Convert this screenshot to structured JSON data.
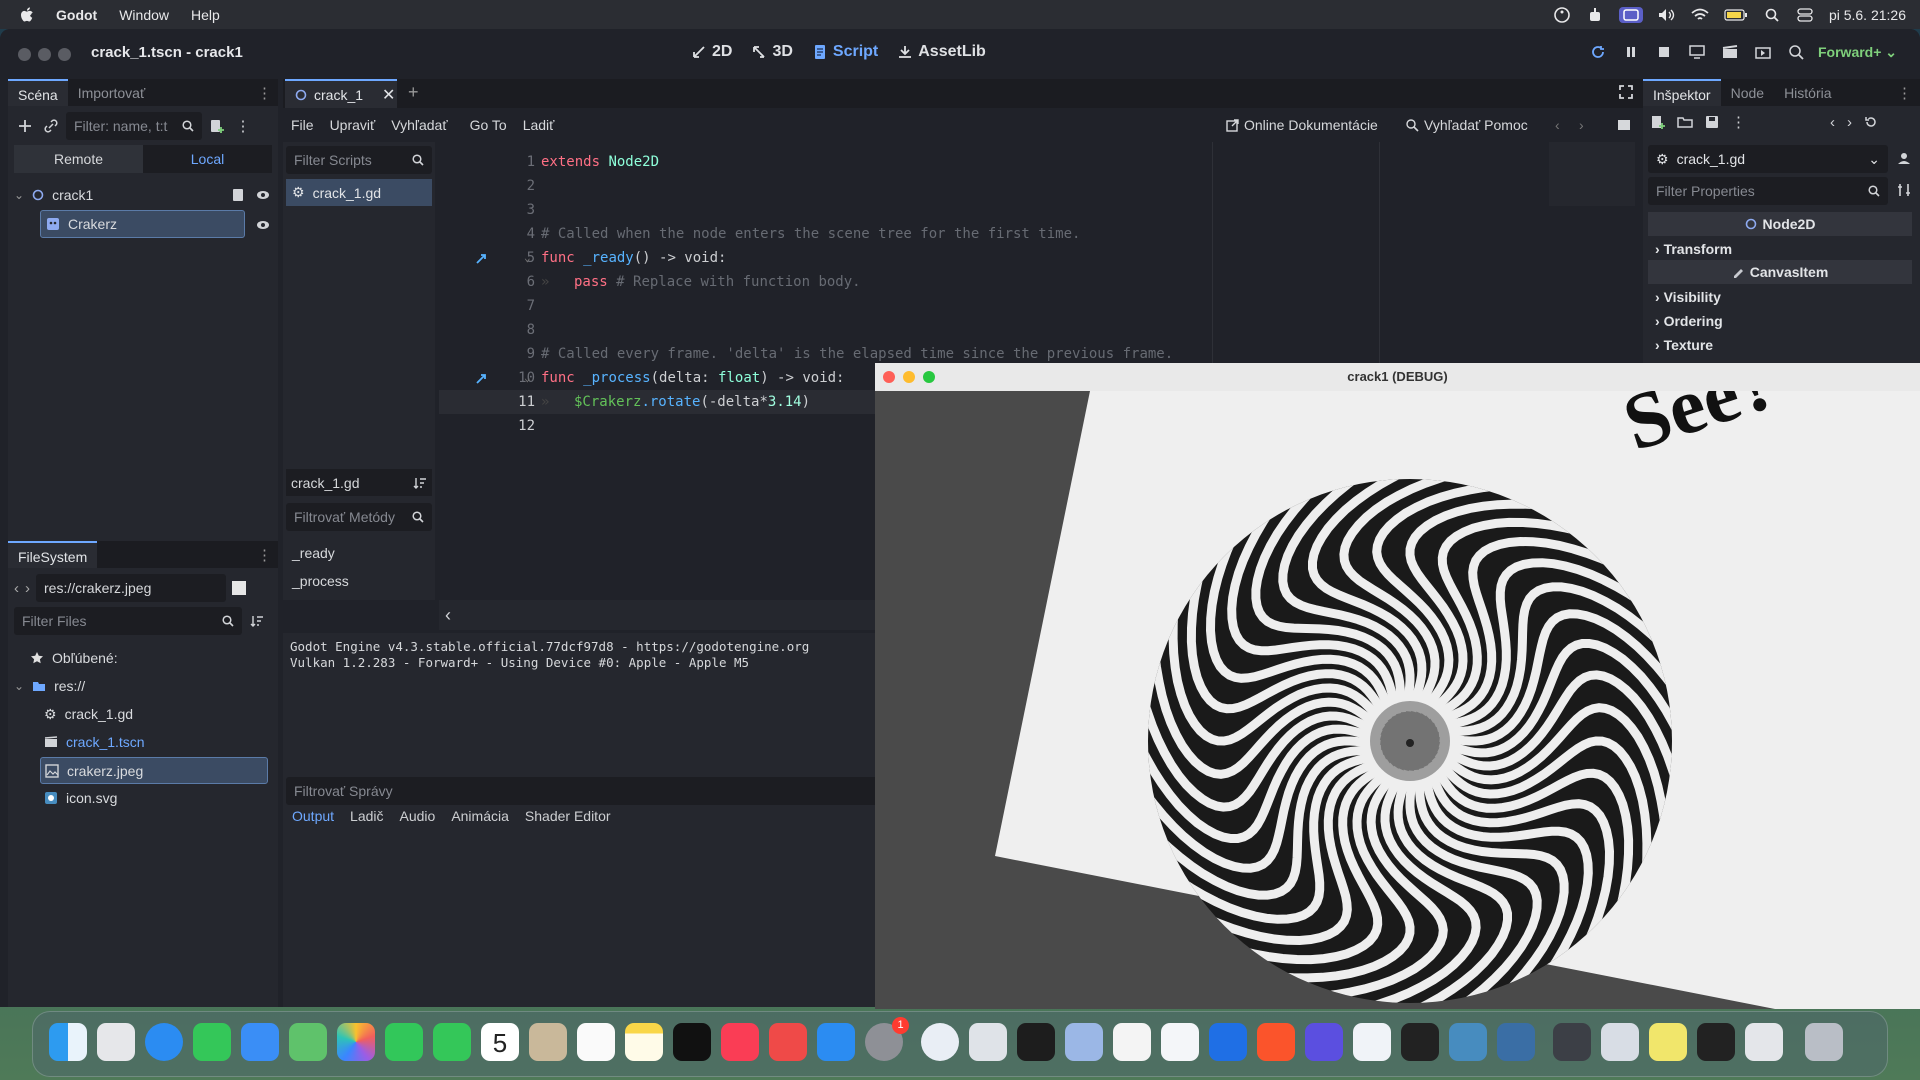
{
  "menubar": {
    "app": "Godot",
    "items": [
      "Window",
      "Help"
    ],
    "clock": "pi 5.6.  21:26"
  },
  "window": {
    "title": "crack_1.tscn - crack1",
    "modes": [
      {
        "label": "2D",
        "icon": "2d-icon"
      },
      {
        "label": "3D",
        "icon": "3d-icon"
      },
      {
        "label": "Script",
        "icon": "script-icon"
      },
      {
        "label": "AssetLib",
        "icon": "assetlib-icon"
      }
    ],
    "renderer": "Forward+"
  },
  "scene": {
    "tabs": [
      "Scéna",
      "Importovať"
    ],
    "filter_placeholder": "Filter: name, t:t",
    "remote": "Remote",
    "local": "Local",
    "nodes": [
      {
        "name": "crack1",
        "icon": "node2d-icon"
      },
      {
        "name": "Crakerz",
        "icon": "sprite-icon"
      }
    ]
  },
  "filesystem": {
    "tab": "FileSystem",
    "path": "res://crakerz.jpeg",
    "filter_placeholder": "Filter Files",
    "favorites": "Obľúbené:",
    "root": "res://",
    "files": [
      {
        "name": "crack_1.gd",
        "icon": "gear-icon"
      },
      {
        "name": "crack_1.tscn",
        "icon": "scene-icon"
      },
      {
        "name": "crakerz.jpeg",
        "icon": "image-icon"
      },
      {
        "name": "icon.svg",
        "icon": "svg-icon"
      }
    ]
  },
  "editor": {
    "tab": "crack_1",
    "menu": [
      "File",
      "Upraviť",
      "Vyhľadať",
      "Go To",
      "Ladiť"
    ],
    "online_docs": "Online Dokumentácie",
    "search_help": "Vyhľadať Pomoc",
    "filter_scripts": "Filter Scripts",
    "script_list": [
      "crack_1.gd"
    ],
    "current_script": "crack_1.gd",
    "filter_methods": "Filtrovať Metódy",
    "methods": [
      "_ready",
      "_process"
    ],
    "lines": [
      "1",
      "2",
      "3",
      "4",
      "5",
      "6",
      "7",
      "8",
      "9",
      "10",
      "11",
      "12"
    ],
    "code": {
      "l1_kw": "extends",
      "l1_ty": "Node2D",
      "l4": "# Called when the node enters the scene tree for the first time.",
      "l5_kw": "func",
      "l5_fn": "_ready",
      "l5_rest": "() -> void:",
      "l6_kw": "pass",
      "l6_cm": "# Replace with function body.",
      "l9": "# Called every frame. 'delta' is the elapsed time since the previous frame.",
      "l10_kw": "func",
      "l10_fn": "_process",
      "l10_arg": "(delta: ",
      "l10_ty": "float",
      "l10_rest": ") -> void:",
      "l11_nd": "$Crakerz",
      "l11_fn": ".rotate",
      "l11_rest": "(-delta*",
      "l11_num": "3.14",
      "l11_close": ")"
    }
  },
  "output": {
    "lines": [
      "Godot Engine v4.3.stable.official.77dcf97d8 - https://godotengine.org",
      "Vulkan 1.2.283 - Forward+ - Using Device #0: Apple - Apple M5"
    ],
    "filter": "Filtrovať Správy",
    "tabs": [
      "Output",
      "Ladič",
      "Audio",
      "Animácia",
      "Shader Editor"
    ]
  },
  "inspector": {
    "tabs": [
      "Inšpektor",
      "Node",
      "História"
    ],
    "resource": "crack_1.gd",
    "filter_placeholder": "Filter Properties",
    "class_node2d": "Node2D",
    "sections": [
      "Transform",
      "Visibility",
      "Ordering",
      "Texture"
    ],
    "class_canvasitem": "CanvasItem"
  },
  "debug_window": {
    "title": "crack1 (DEBUG)",
    "image_text": "See?"
  },
  "dock": {
    "calendar_day": "5",
    "badge": "1"
  }
}
